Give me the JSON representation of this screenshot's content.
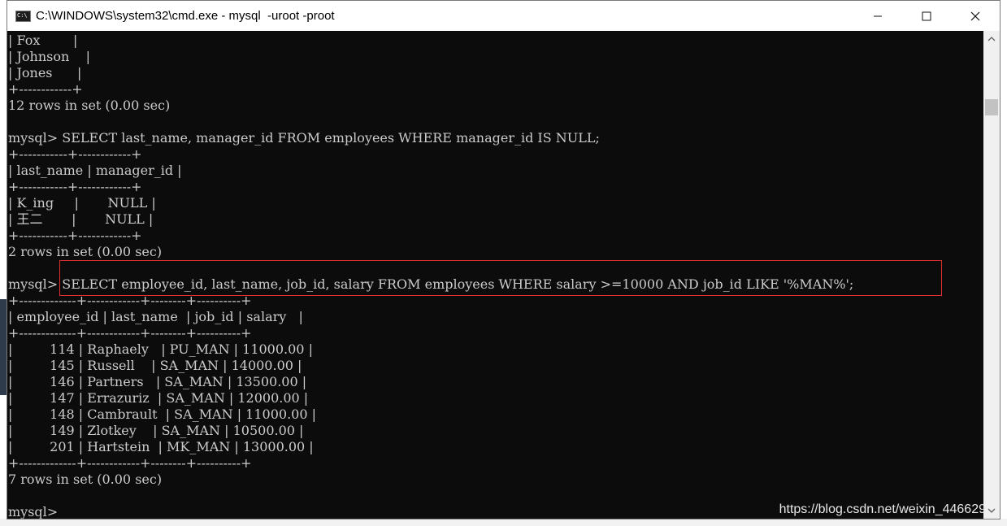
{
  "window": {
    "title": "C:\\WINDOWS\\system32\\cmd.exe - mysql  -uroot -proot",
    "controls": {
      "minimize": "minimize",
      "maximize": "maximize",
      "close": "close"
    }
  },
  "terminal": {
    "lines": [
      "| Fox        |",
      "| Johnson    |",
      "| Jones      |",
      "+------------+",
      "12 rows in set (0.00 sec)",
      "",
      "mysql> SELECT last_name, manager_id FROM employees WHERE manager_id IS NULL;",
      "+-----------+------------+",
      "| last_name | manager_id |",
      "+-----------+------------+",
      "| K_ing     |       NULL |",
      "| 王二       |       NULL |",
      "+-----------+------------+",
      "2 rows in set (0.00 sec)",
      "",
      "mysql> SELECT employee_id, last_name, job_id, salary FROM employees WHERE salary >=10000 AND job_id LIKE '%MAN%';",
      "+-------------+------------+--------+----------+",
      "| employee_id | last_name  | job_id | salary   |",
      "+-------------+------------+--------+----------+",
      "|         114 | Raphaely   | PU_MAN | 11000.00 |",
      "|         145 | Russell    | SA_MAN | 14000.00 |",
      "|         146 | Partners   | SA_MAN | 13500.00 |",
      "|         147 | Errazuriz  | SA_MAN | 12000.00 |",
      "|         148 | Cambrault  | SA_MAN | 11000.00 |",
      "|         149 | Zlotkey    | SA_MAN | 10500.00 |",
      "|         201 | Hartstein  | MK_MAN | 13000.00 |",
      "+-------------+------------+--------+----------+",
      "7 rows in set (0.00 sec)",
      "",
      "mysql>"
    ]
  },
  "watermark": "https://blog.csdn.net/weixin_446629",
  "colors": {
    "console_bg": "#0c0c0c",
    "console_text": "#cccccc",
    "highlight": "#e03030"
  },
  "icons": {
    "app": "cmd-icon",
    "scroll_up": "chevron-up-icon",
    "scroll_down": "chevron-down-icon"
  }
}
